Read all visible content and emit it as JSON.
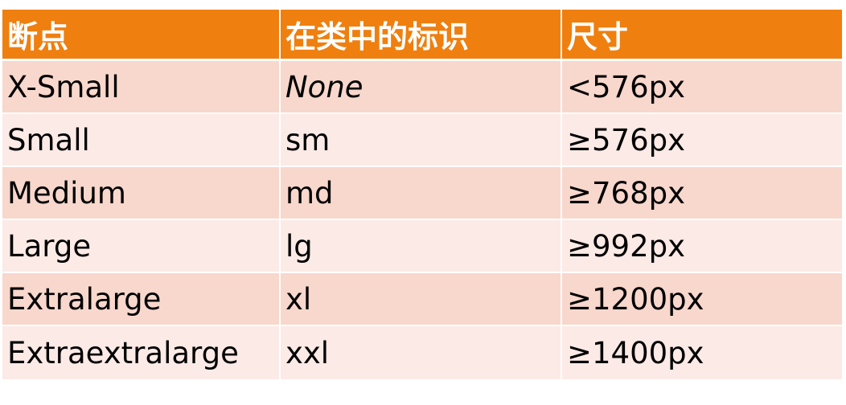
{
  "table": {
    "headers": [
      "断点",
      "在类中的标识",
      "尺寸"
    ],
    "rows": [
      {
        "breakpoint": "X-Small",
        "class_infix": "None",
        "dimension": "<576px"
      },
      {
        "breakpoint": "Small",
        "class_infix": "sm",
        "dimension": "≥576px"
      },
      {
        "breakpoint": "Medium",
        "class_infix": "md",
        "dimension": "≥768px"
      },
      {
        "breakpoint": "Large",
        "class_infix": "lg",
        "dimension": "≥992px"
      },
      {
        "breakpoint": "Extralarge",
        "class_infix": "xl",
        "dimension": "≥1200px"
      },
      {
        "breakpoint": "Extraextralarge",
        "class_infix": "xxl",
        "dimension": "≥1400px"
      }
    ],
    "colors": {
      "header_bg": "#EF7F0F",
      "header_text": "#FFFFFF",
      "row_odd_bg": "#F8D7CC",
      "row_even_bg": "#FBEAE6",
      "cell_text": "#000000"
    }
  }
}
